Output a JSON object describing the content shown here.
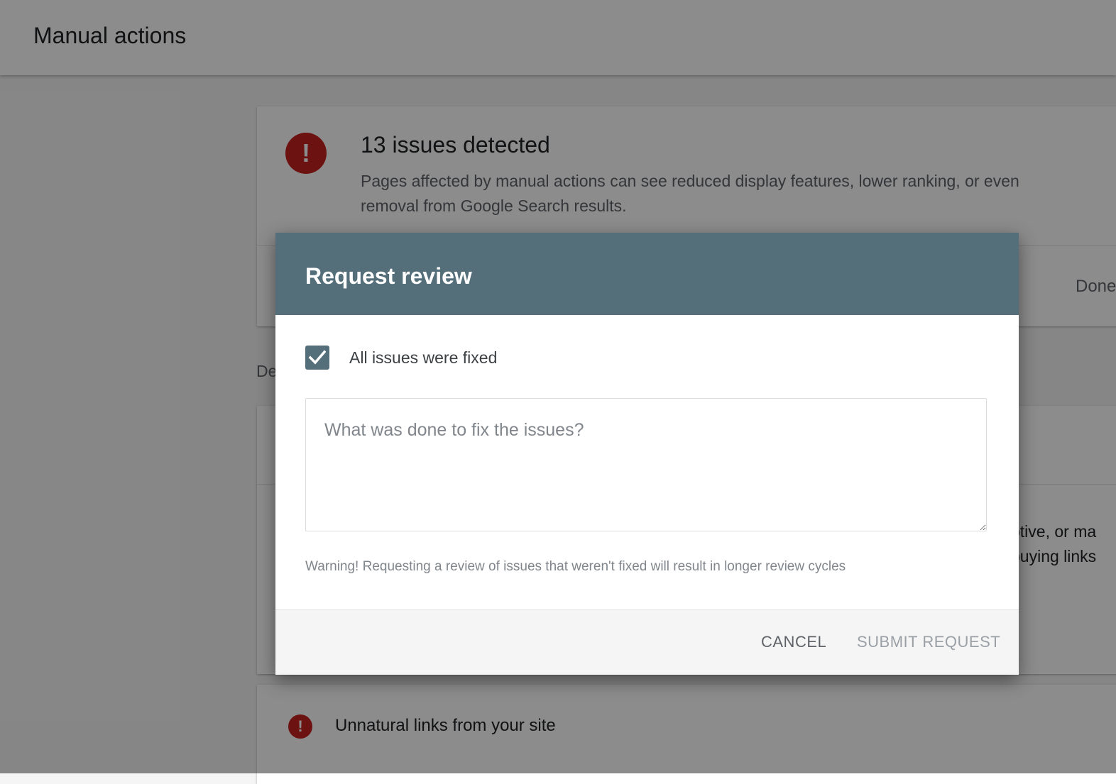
{
  "header": {
    "title": "Manual actions"
  },
  "summary": {
    "icon": "error-icon",
    "title": "13 issues detected",
    "description": "Pages affected by manual actions can see reduced display features, lower ranking, or even removal from Google Search results.",
    "done_label_fragment": "Done"
  },
  "details_label_fragment": "De",
  "issue": {
    "text_line1": "ptive, or ma",
    "text_line2": "buying links"
  },
  "links_issue": {
    "icon": "error-icon",
    "label": "Unnatural links from your site"
  },
  "dialog": {
    "title": "Request review",
    "checkbox": {
      "label": "All issues were fixed",
      "checked": true
    },
    "textarea": {
      "value": "",
      "placeholder": "What was done to fix the issues?"
    },
    "warning": "Warning! Requesting a review of issues that weren't fixed will result in longer review cycles",
    "cancel_label": "CANCEL",
    "submit_label": "SUBMIT REQUEST"
  },
  "colors": {
    "dialog_header": "#546e7a",
    "error": "#c5221f",
    "submit_disabled": "#9aa0a6"
  }
}
